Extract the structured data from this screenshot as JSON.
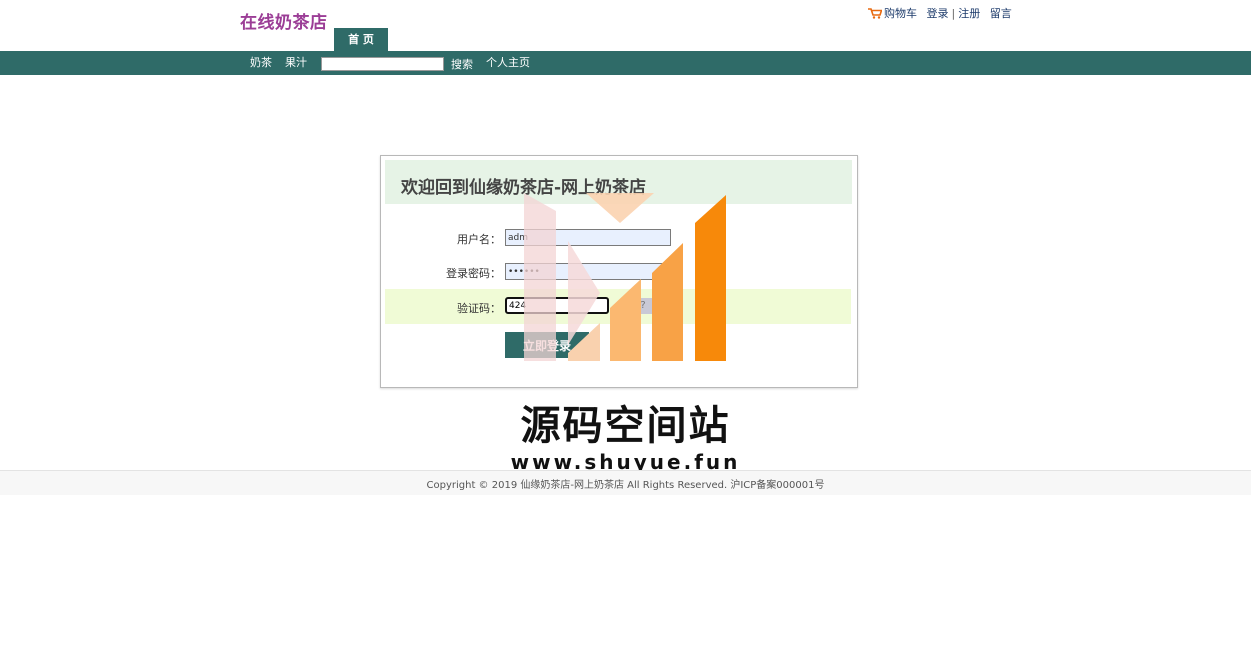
{
  "header": {
    "logo": "在线奶茶店",
    "home_tab": "首 页",
    "cart": "购物车",
    "login": "登录",
    "divider": "|",
    "register": "注册",
    "message": "留言"
  },
  "nav": {
    "items": [
      "奶茶",
      "果汁"
    ],
    "search_value": "",
    "search_button": "搜索",
    "profile": "个人主页"
  },
  "login_box": {
    "welcome": "欢迎回到仙缘奶茶店-网上奶茶店",
    "username_label": "用户名：",
    "username_value": "adm",
    "password_label": "登录密码：",
    "password_value": "••••••",
    "captcha_label": "验证码：",
    "captcha_value": "424",
    "captcha_image_text": "?",
    "submit": "立即登录"
  },
  "watermark": {
    "name": "源码空间站",
    "url": "www.shuyue.fun"
  },
  "footer": {
    "copyright": "Copyright © 2019 仙缘奶茶店-网上奶茶店 All Rights Reserved. 沪ICP备案000001号"
  },
  "colors": {
    "brand": "#2f6b68",
    "logo": "#9b3d96",
    "welcome_bg": "#e6f3e6",
    "captcha_bg": "#f0fbd6",
    "watermark_orange": "#f7890a"
  }
}
